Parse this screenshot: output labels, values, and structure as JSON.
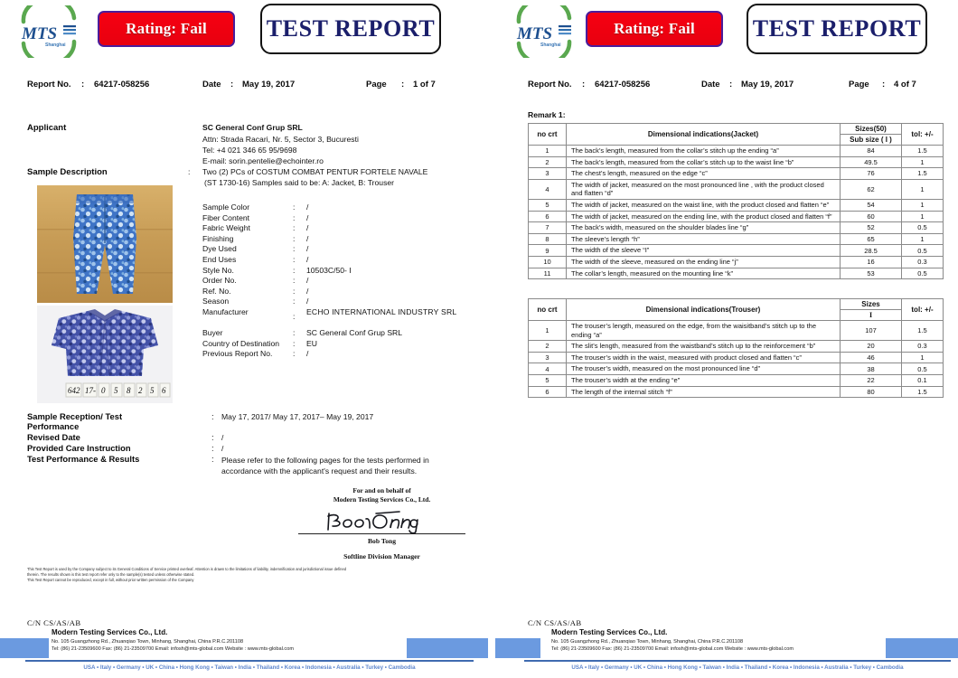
{
  "brand": {
    "logo_icon": "mts-shanghai-logo",
    "logo_text": "MTS",
    "logo_sub": "Shanghai",
    "accent_blue": "#1b1f6b",
    "accent_green": "#5aa84f",
    "rating_red": "#f60012",
    "rating_border": "#4b1d9c",
    "footer_blue": "#6b9ae0"
  },
  "pages": [
    {
      "rating_badge": "Rating: Fail",
      "report_title": "TEST REPORT",
      "meta": {
        "report_no_label": "Report No.",
        "report_no_value": "64217-058256",
        "date_label": "Date",
        "date_value": "May 19, 2017",
        "page_label": "Page",
        "page_value": "1 of 7",
        "colon": ":"
      }
    },
    {
      "rating_badge": "Rating: Fail",
      "report_title": "TEST REPORT",
      "meta": {
        "report_no_label": "Report No.",
        "report_no_value": "64217-058256",
        "date_label": "Date",
        "date_value": "May 19, 2017",
        "page_label": "Page",
        "page_value": "4 of 7",
        "colon": ":"
      }
    }
  ],
  "applicant": {
    "label": "Applicant",
    "name": "SC General Conf Grup SRL",
    "address": "Attn: Strada Racari, Nr. 5, Sector 3, Bucuresti",
    "phone": "Tel: +4 021 346 65 95/9698",
    "email": "E-mail: sorin.pentelie@echointer.ro"
  },
  "sample_description": {
    "label": "Sample Description",
    "colon": ":",
    "line1": "Two (2) PCs of COSTUM COMBAT PENTUR FORTELE NAVALE",
    "line2": "(ST 1730-16)  Samples said to be: A: Jacket, B: Trouser",
    "fields": [
      {
        "key": "Sample Color",
        "value": "/"
      },
      {
        "key": "Fiber Content",
        "value": "/"
      },
      {
        "key": "Fabric Weight",
        "value": "/"
      },
      {
        "key": "Finishing",
        "value": "/"
      },
      {
        "key": "Dye Used",
        "value": "/"
      },
      {
        "key": "End Uses",
        "value": "/"
      },
      {
        "key": "Style No.",
        "value": "10503C/50-  I"
      },
      {
        "key": "Order No.",
        "value": "/"
      },
      {
        "key": "Ref. No.",
        "value": "/"
      },
      {
        "key": "Season",
        "value": "/"
      },
      {
        "key": "Manufacturer",
        "value": "ECHO   INTERNATIONAL   INDUSTRY  SRL"
      },
      {
        "key": "Buyer",
        "value": "SC General Conf Grup SRL"
      },
      {
        "key": "Country of Destination",
        "value": "EU"
      },
      {
        "key": "Previous Report No.",
        "value": "/"
      }
    ],
    "photo_a_caption": "camouflage-trouser-photo",
    "photo_b_caption": "camouflage-jacket-photo",
    "photo_b_tag": "642 17-0 5 8 2 5 6"
  },
  "reception": {
    "row1_label_l1": "Sample Reception/ Test",
    "row1_label_l2": "Performance",
    "row1_value": "May 17, 2017/ May 17, 2017– May 19, 2017",
    "row2_label": "Revised Date",
    "row2_value": "/",
    "row3_label": "Provided Care Instruction",
    "row3_value": "/",
    "row4_label": "Test Performance & Results",
    "row4_value": "Please refer to the following pages for the tests performed in accordance with the applicant's request and their results.",
    "colon": ":"
  },
  "signature": {
    "behalf_l1": "For and on behalf of",
    "behalf_l2": "Modern Testing Services Co., Ltd.",
    "scribble_icon": "handwritten-signature",
    "name": "Bob Tong",
    "role": "Softline Division  Manager"
  },
  "disclaimer": {
    "l1": "This Test Report is used by the Company subject to its General Conditions of Service printed overleaf. Attention is drawn to the limitations of liability, indemnification and jurisdictional issue defined",
    "l2": "therein. The results shown is this test report refer only to the sample(s) tested unless otherwise stated.",
    "l3": "This Test Report cannot be reproduced, except in full, without prior written permission of the Company"
  },
  "footer": {
    "cn_code": "C/N CS/AS/AB",
    "company": "Modern Testing Services Co., Ltd.",
    "address": "No. 105 Guangzhong Rd., Zhuanqiao Town, Minhang, Shanghai, China P.R.C.201108",
    "contact": "Tel: (86) 21-23509600    Fax: (86) 21-23509700    Email: infosh@mts-global.com   Website : www.mts-global.com",
    "countries": "USA • Italy • Germany • UK • China • Hong Kong • Taiwan • India • Thailand • Korea • Indonesia • Australia • Turkey • Cambodia"
  },
  "right_page": {
    "remark_label": "Remark 1:",
    "jacket_table": {
      "headers": {
        "no": "no crt",
        "desc": "Dimensional indications(Jacket)",
        "size_group": "Sizes(50)",
        "size_sub": "Sub size ( I )",
        "tol": "tol: +/-"
      },
      "rows": [
        {
          "no": "1",
          "desc": "The back’s length, measured from the collar’s stitch up the ending “a”",
          "value": "84",
          "tol": "1.5"
        },
        {
          "no": "2",
          "desc": "The back’s length, measured from the collar’s stitch up to the waist line “b”",
          "value": "49.5",
          "tol": "1"
        },
        {
          "no": "3",
          "desc": "The chest’s length, measured on the edge “c”",
          "value": "76",
          "tol": "1.5"
        },
        {
          "no": "4",
          "desc": "The width of jacket, measured on the most pronounced line , with the product closed and flatten “d”",
          "value": "62",
          "tol": "1"
        },
        {
          "no": "5",
          "desc": "The width of jacket, measured on the waist line, with the product closed and flatten “e”",
          "value": "54",
          "tol": "1"
        },
        {
          "no": "6",
          "desc": "The width of jacket, measured on the ending line, with the product closed and flatten “f”",
          "value": "60",
          "tol": "1"
        },
        {
          "no": "7",
          "desc": "The back’s width, measured on the shoulder blades line “g”",
          "value": "52",
          "tol": "0.5"
        },
        {
          "no": "8",
          "desc": "The sleeve’s length “h”",
          "value": "65",
          "tol": "1"
        },
        {
          "no": "9",
          "desc": "The width of the sleeve “I”",
          "value": "28.5",
          "tol": "0.5"
        },
        {
          "no": "10",
          "desc": "The width of the sleeve, measured on the ending line “j”",
          "value": "16",
          "tol": "0.3"
        },
        {
          "no": "11",
          "desc": "The collar’s length, measured on the mounting line “k”",
          "value": "53",
          "tol": "0.5"
        }
      ]
    },
    "trouser_table": {
      "headers": {
        "no": "no crt",
        "desc": "Dimensional indications(Trouser)",
        "size_group": "Sizes",
        "size_sub": "I",
        "tol": "tol: +/-"
      },
      "rows": [
        {
          "no": "1",
          "desc": "The trouser’s length, measured on the edge, from the waisitband’s stitch up to the ending “a”",
          "value": "107",
          "tol": "1.5"
        },
        {
          "no": "2",
          "desc": "The slit’s length, measured from the waistband’s stitch up to the reinforcement “b”",
          "value": "20",
          "tol": "0.3"
        },
        {
          "no": "3",
          "desc": "The trouser’s width in the waist, measured with product closed and flatten “c”",
          "value": "46",
          "tol": "1"
        },
        {
          "no": "4",
          "desc": "The trouser’s width, measured on the most pronounced line “d”",
          "value": "38",
          "tol": "0.5"
        },
        {
          "no": "5",
          "desc": "The trouser’s width at the ending “e”",
          "value": "22",
          "tol": "0.1"
        },
        {
          "no": "6",
          "desc": "The length of the internal stitch “f”",
          "value": "80",
          "tol": "1.5"
        }
      ]
    }
  }
}
